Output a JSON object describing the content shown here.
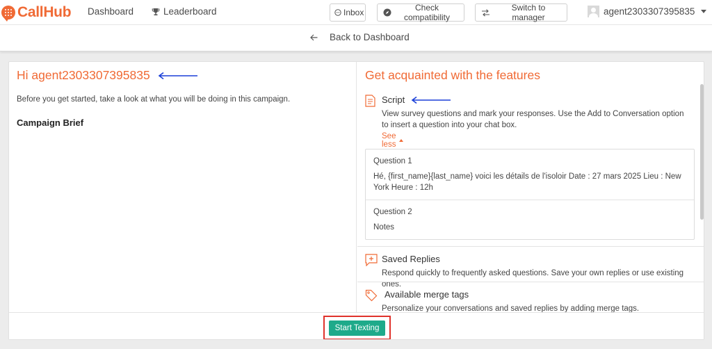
{
  "brand": {
    "name": "CallHub",
    "color": "#f06a35"
  },
  "nav": {
    "dashboard": "Dashboard",
    "leaderboard": "Leaderboard",
    "inbox": "Inbox",
    "check_compatibility": "Check compatibility",
    "switch_to_manager": "Switch to manager",
    "username": "agent2303307395835"
  },
  "back": {
    "label": "Back to Dashboard"
  },
  "left": {
    "greeting": "Hi agent2303307395835",
    "intro": "Before you get started, take a look at what you will be doing in this campaign.",
    "brief_title": "Campaign Brief"
  },
  "right": {
    "title": "Get acquainted with the features",
    "script": {
      "title": "Script",
      "desc": "View survey questions and mark your responses. Use the Add to Conversation option to insert a question into your chat box.",
      "see_less": "See less",
      "questions": [
        {
          "title": "Question 1",
          "text": "Hé, {first_name}{last_name} voici les détails de l'isoloir Date : 27 mars 2025 Lieu : New York Heure : 12h"
        },
        {
          "title": "Question 2",
          "text": "Notes"
        }
      ]
    },
    "saved_replies": {
      "title": "Saved Replies",
      "desc": "Respond quickly to frequently asked questions. Save your own replies or use existing ones."
    },
    "merge_tags": {
      "title": "Available merge tags",
      "desc": "Personalize your conversations and saved replies by adding merge tags."
    }
  },
  "footer": {
    "start_label": "Start Texting",
    "button_color": "#1eaa8a",
    "highlight_color": "#e0322b"
  },
  "icons": [
    "callhub-logo-icon",
    "trophy-icon",
    "chat-bubble-icon",
    "compass-icon",
    "swap-arrows-icon",
    "avatar-icon",
    "chevron-down-icon",
    "arrow-left-icon",
    "document-icon",
    "chat-plus-icon",
    "tag-icon",
    "annotation-arrow-icon"
  ]
}
